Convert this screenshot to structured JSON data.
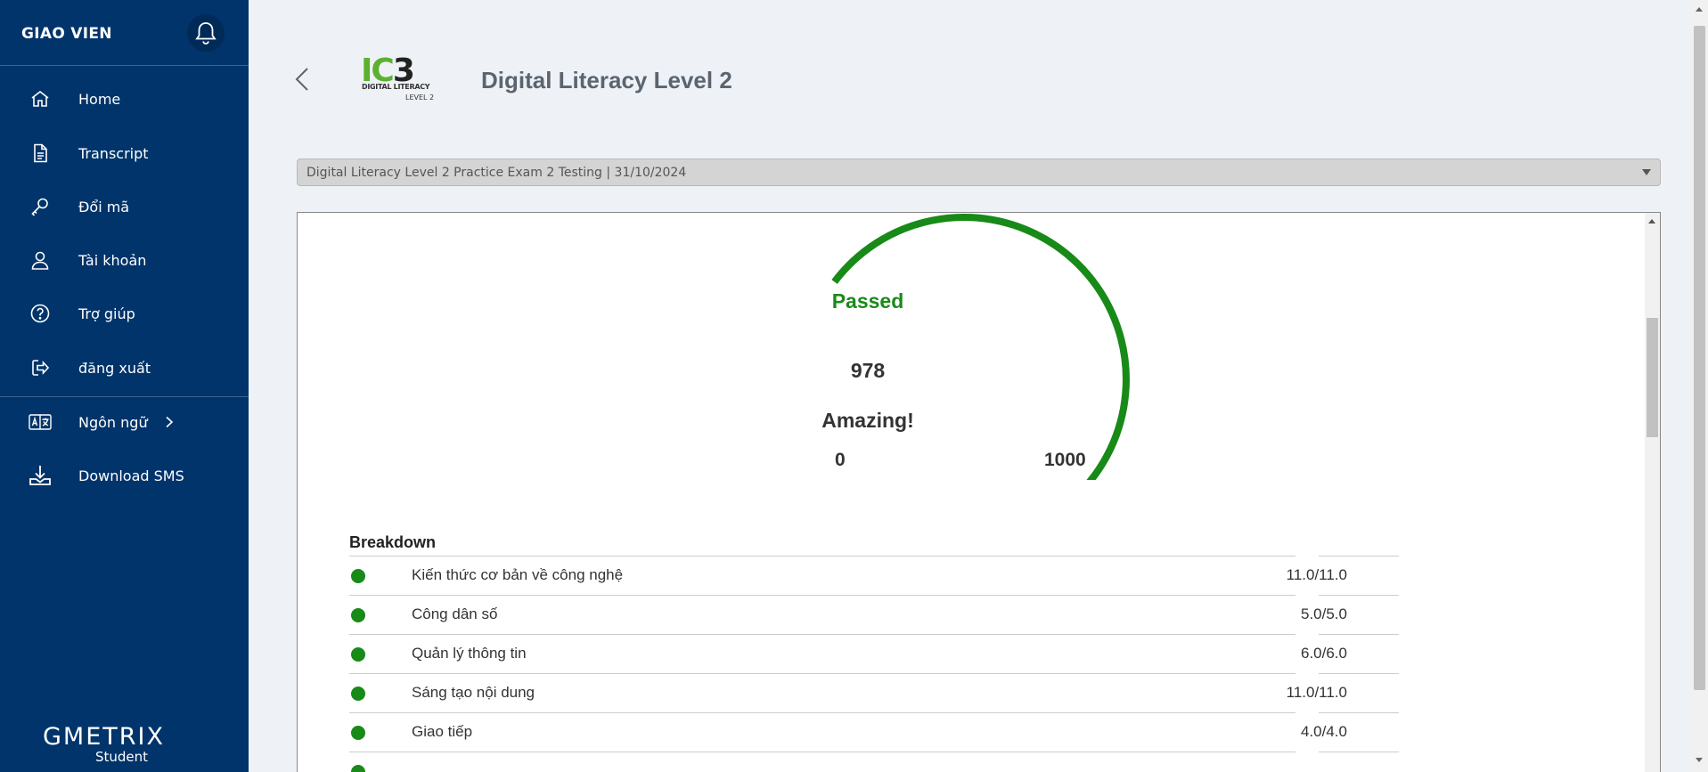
{
  "sidebar": {
    "user": "GIAO VIEN",
    "items": [
      {
        "label": "Home",
        "icon": "home-icon"
      },
      {
        "label": "Transcript",
        "icon": "document-icon"
      },
      {
        "label": "Đổi mã",
        "icon": "key-icon"
      },
      {
        "label": "Tài khoản",
        "icon": "user-icon"
      },
      {
        "label": "Trợ giúp",
        "icon": "help-circle-icon"
      },
      {
        "label": "đăng xuất",
        "icon": "logout-icon"
      },
      {
        "label": "Ngôn ngữ",
        "icon": "language-icon"
      },
      {
        "label": "Download SMS",
        "icon": "download-icon"
      }
    ],
    "brand": "GMETRIX",
    "brand_sub": "Student"
  },
  "header": {
    "logo_text": "IC3",
    "logo_sub1": "DIGITAL LITERACY",
    "logo_sub2": "LEVEL 2",
    "title": "Digital Literacy Level 2"
  },
  "exam_select": {
    "selected": "Digital Literacy Level 2 Practice Exam 2 Testing | 31/10/2024"
  },
  "result": {
    "status": "Passed",
    "score": 978,
    "score_text": "978",
    "comment": "Amazing!",
    "min": "0",
    "max": "1000",
    "score_fraction": 0.978,
    "colors": {
      "pass": "#178a17",
      "track": "#dcdcdc"
    }
  },
  "breakdown": {
    "title": "Breakdown",
    "rows": [
      {
        "label": "Kiến thức cơ bản về công nghệ",
        "score": "11.0/11.0"
      },
      {
        "label": "Công dân số",
        "score": "5.0/5.0"
      },
      {
        "label": "Quản lý thông tin",
        "score": "6.0/6.0"
      },
      {
        "label": "Sáng tạo nội dung",
        "score": "11.0/11.0"
      },
      {
        "label": "Giao tiếp",
        "score": "4.0/4.0"
      }
    ]
  },
  "colors": {
    "sidebar": "#00346a",
    "accent_green": "#1a8a1a",
    "ic3_green": "#5cb130"
  }
}
